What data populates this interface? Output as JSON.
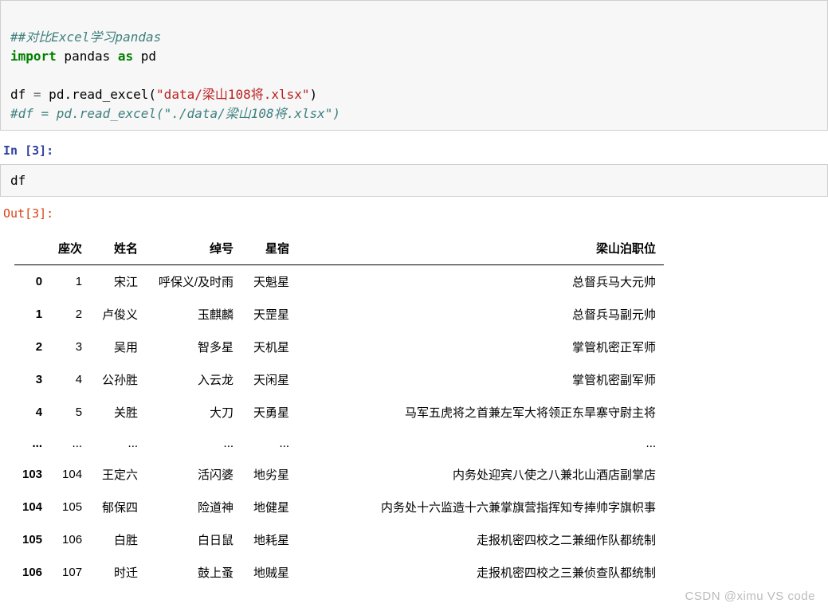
{
  "cell1": {
    "line1": "##对比Excel学习pandas",
    "line2_kw1": "import",
    "line2_mid": " pandas ",
    "line2_kw2": "as",
    "line2_end": " pd",
    "line3_var": "df ",
    "line3_op": "=",
    "line3_call": " pd.read_excel(",
    "line3_str": "\"data/梁山108将.xlsx\"",
    "line3_close": ")",
    "line4": "#df = pd.read_excel(\"./data/梁山108将.xlsx\")"
  },
  "prompt_in_label": "In [3]:",
  "input_code": "df",
  "prompt_out_label": "Out[3]:",
  "table": {
    "headers": [
      "座次",
      "姓名",
      "绰号",
      "星宿",
      "梁山泊职位"
    ],
    "rows": [
      {
        "idx": "0",
        "c": [
          "1",
          "宋江",
          "呼保义/及时雨",
          "天魁星",
          "总督兵马大元帅"
        ]
      },
      {
        "idx": "1",
        "c": [
          "2",
          "卢俊义",
          "玉麒麟",
          "天罡星",
          "总督兵马副元帅"
        ]
      },
      {
        "idx": "2",
        "c": [
          "3",
          "吴用",
          "智多星",
          "天机星",
          "掌管机密正军师"
        ]
      },
      {
        "idx": "3",
        "c": [
          "4",
          "公孙胜",
          "入云龙",
          "天闲星",
          "掌管机密副军师"
        ]
      },
      {
        "idx": "4",
        "c": [
          "5",
          "关胜",
          "大刀",
          "天勇星",
          "马军五虎将之首兼左军大将领正东旱寨守尉主将"
        ]
      },
      {
        "idx": "...",
        "c": [
          "...",
          "...",
          "...",
          "...",
          "..."
        ]
      },
      {
        "idx": "103",
        "c": [
          "104",
          "王定六",
          "活闪婆",
          "地劣星",
          "内务处迎宾八使之八兼北山酒店副掌店"
        ]
      },
      {
        "idx": "104",
        "c": [
          "105",
          "郁保四",
          "险道神",
          "地健星",
          "内务处十六监造十六兼掌旗营指挥知专捧帅字旗帜事"
        ]
      },
      {
        "idx": "105",
        "c": [
          "106",
          "白胜",
          "白日鼠",
          "地耗星",
          "走报机密四校之二兼细作队都统制"
        ]
      },
      {
        "idx": "106",
        "c": [
          "107",
          "时迁",
          "鼓上蚤",
          "地贼星",
          "走报机密四校之三兼侦查队都统制"
        ]
      }
    ]
  },
  "watermark": "CSDN @ximu VS code"
}
